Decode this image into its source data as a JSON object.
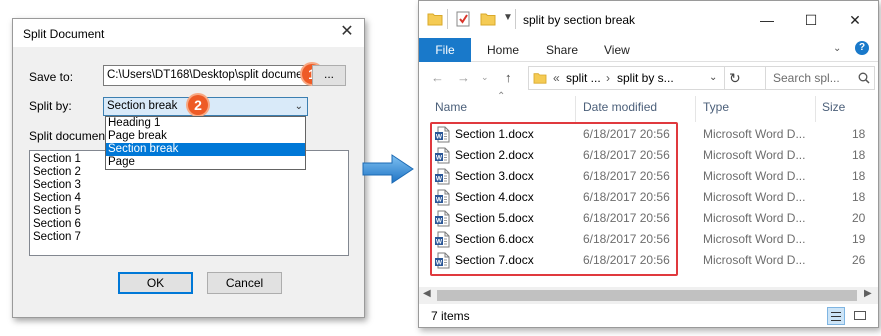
{
  "dialog": {
    "title": "Split Document",
    "close_glyph": "✕",
    "save_label": "Save to:",
    "save_path": "C:\\Users\\DT168\\Desktop\\split documen",
    "browse_label": "...",
    "split_label": "Split by:",
    "split_value": "Section break",
    "dropdown_options": [
      "Heading 1",
      "Page break",
      "Section break",
      "Page"
    ],
    "doc_list_label": "Split document",
    "doc_items": [
      "Section 1",
      "Section 2",
      "Section 3",
      "Section 4",
      "Section 5",
      "Section 6",
      "Section 7"
    ],
    "ok_label": "OK",
    "cancel_label": "Cancel",
    "badge1": "1",
    "badge2": "2"
  },
  "explorer": {
    "title": "split by section break",
    "minimize_glyph": "—",
    "maximize_glyph": "☐",
    "close_glyph": "✕",
    "tabs": [
      "File",
      "Home",
      "Share",
      "View"
    ],
    "address_prefix": "«",
    "address_part1": "split ...",
    "address_sep": "›",
    "address_part2": "split by s...",
    "search_placeholder": "Search spl...",
    "columns": {
      "name": "Name",
      "date": "Date modified",
      "type": "Type",
      "size": "Size"
    },
    "files": [
      {
        "name": "Section 1.docx",
        "date": "6/18/2017 20:56",
        "type": "Microsoft Word D...",
        "size": "18"
      },
      {
        "name": "Section 2.docx",
        "date": "6/18/2017 20:56",
        "type": "Microsoft Word D...",
        "size": "18"
      },
      {
        "name": "Section 3.docx",
        "date": "6/18/2017 20:56",
        "type": "Microsoft Word D...",
        "size": "18"
      },
      {
        "name": "Section 4.docx",
        "date": "6/18/2017 20:56",
        "type": "Microsoft Word D...",
        "size": "18"
      },
      {
        "name": "Section 5.docx",
        "date": "6/18/2017 20:56",
        "type": "Microsoft Word D...",
        "size": "20"
      },
      {
        "name": "Section 6.docx",
        "date": "6/18/2017 20:56",
        "type": "Microsoft Word D...",
        "size": "19"
      },
      {
        "name": "Section 7.docx",
        "date": "6/18/2017 20:56",
        "type": "Microsoft Word D...",
        "size": "26"
      }
    ],
    "status": "7 items"
  },
  "colors": {
    "accent": "#0078d7",
    "file_tab": "#1979ca",
    "badge": "#ee5b26",
    "highlight": "#e0393e",
    "arrow": "#2a86d1"
  }
}
